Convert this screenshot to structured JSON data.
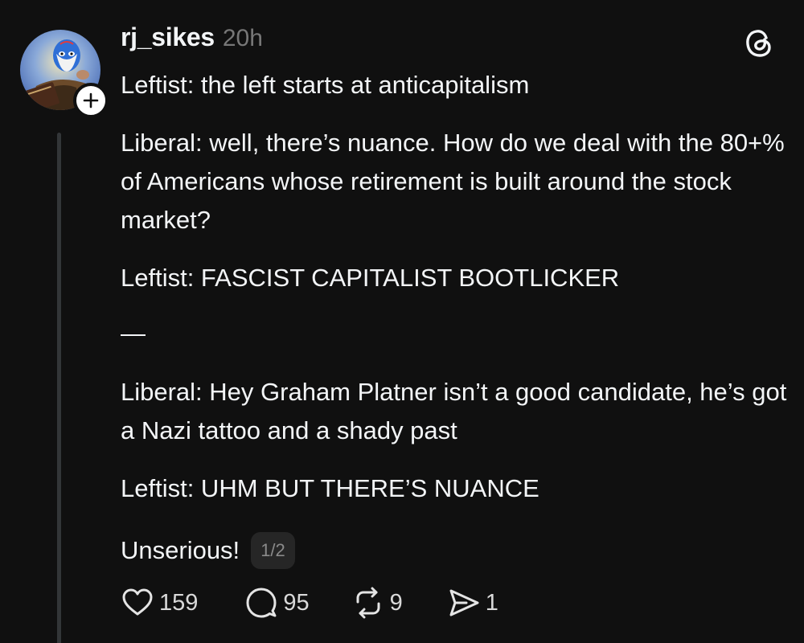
{
  "post": {
    "username": "rj_sikes",
    "timestamp": "20h",
    "paragraphs": [
      "Leftist: the left starts at anticapitalism",
      "Liberal: well, there’s nuance. How do we deal with the 80+% of Americans whose retirement is built around the stock market?",
      "Leftist: FASCIST CAPITALIST BOOTLICKER",
      "—",
      "Liberal: Hey Graham Platner isn’t a good candidate, he’s got a Nazi tattoo and a shady past",
      "Leftist: UHM BUT THERE’S NUANCE",
      "Unserious!"
    ],
    "page_indicator": "1/2"
  },
  "actions": {
    "likes": "159",
    "replies": "95",
    "reposts": "9",
    "shares": "1"
  },
  "icons": {
    "logo": "threads-logo-icon",
    "follow": "plus-icon",
    "like": "heart-icon",
    "reply": "comment-bubble-icon",
    "repost": "repost-icon",
    "share": "send-icon"
  },
  "colors": {
    "background": "#101010",
    "text": "#f3f5f7",
    "muted": "#777777",
    "thread_line": "#333638"
  }
}
